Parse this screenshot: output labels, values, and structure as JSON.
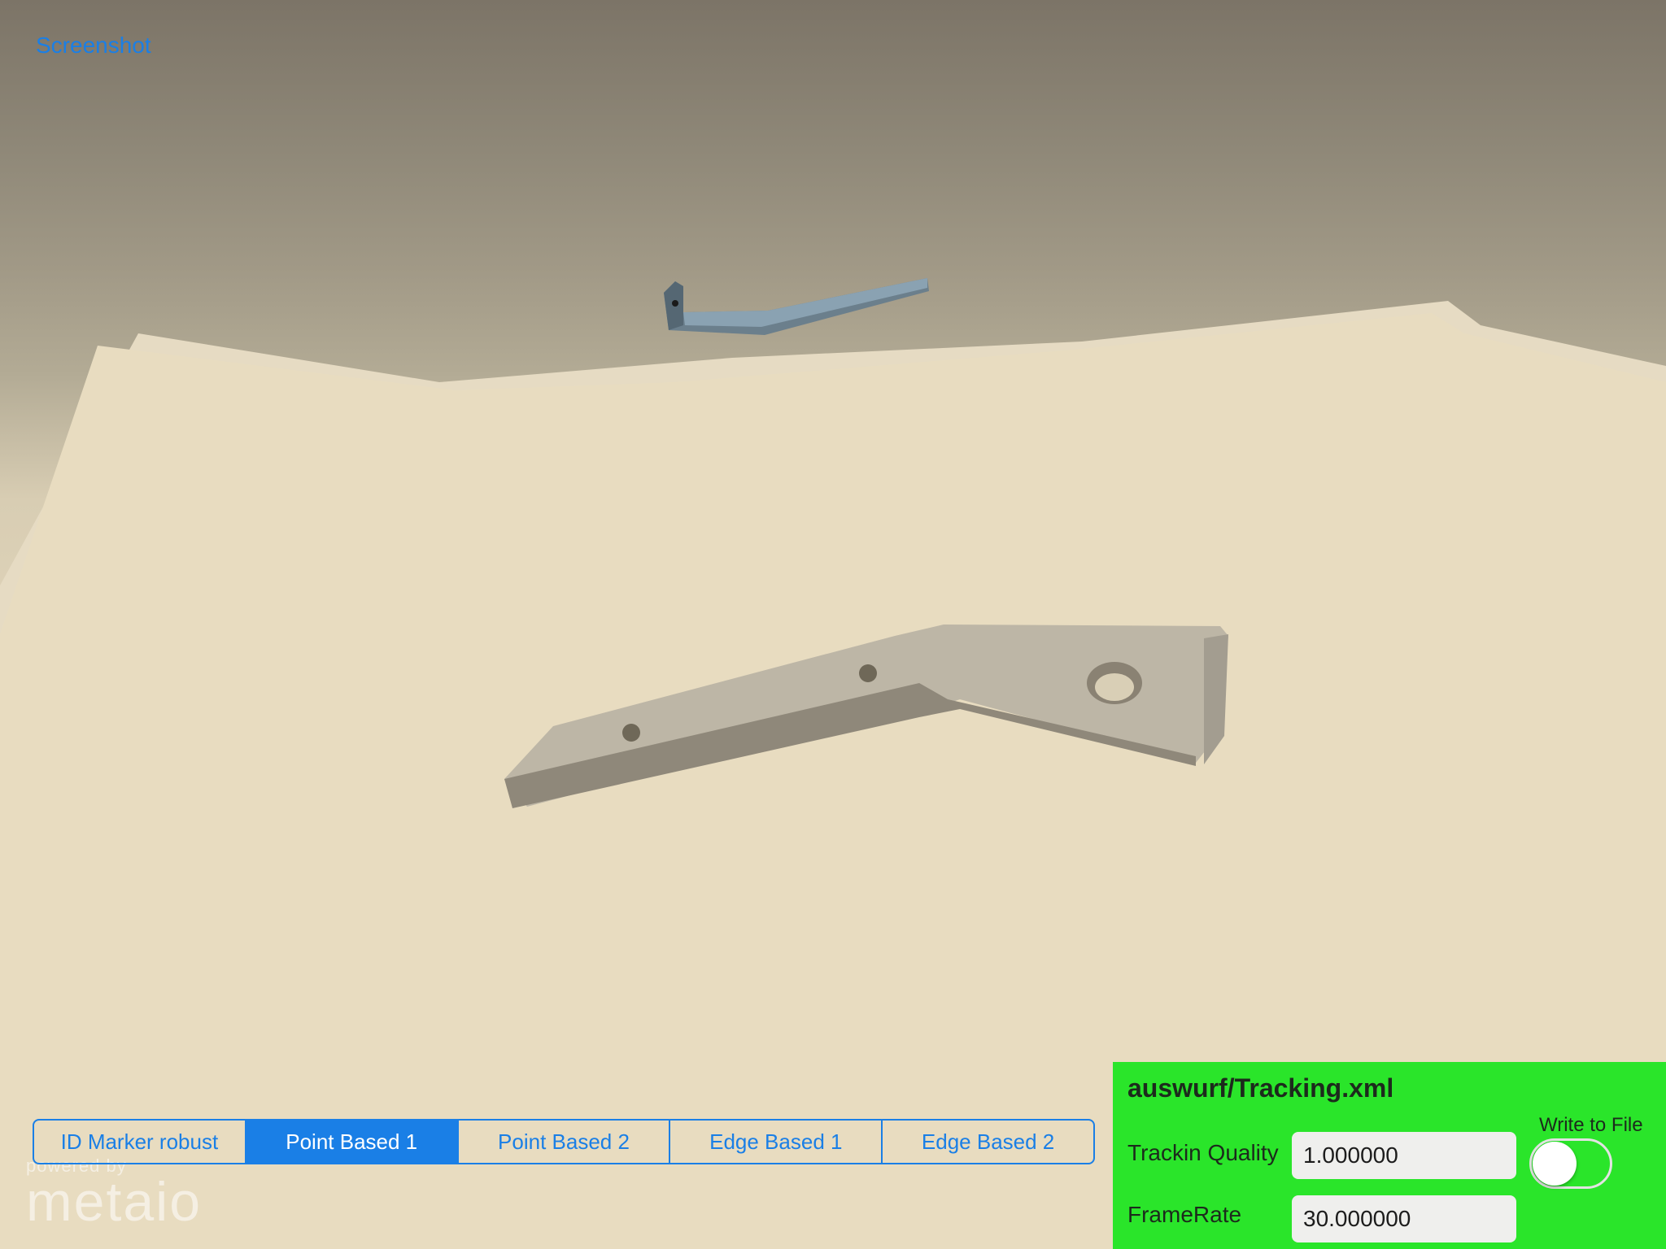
{
  "toolbar": {
    "screenshot_label": "Screenshot"
  },
  "tracking_modes": {
    "items": [
      "ID Marker robust",
      "Point Based 1",
      "Point Based 2",
      "Edge Based 1",
      "Edge Based 2"
    ],
    "selected": "Point Based 1"
  },
  "watermark": {
    "powered_by": "powered by",
    "logo": "metaio"
  },
  "info_panel": {
    "title": "auswurf/Tracking.xml",
    "quality_label": "Trackin Quality",
    "quality_value": "1.000000",
    "framerate_label": "FrameRate",
    "framerate_value": "30.000000",
    "write_to_file_label": "Write to File",
    "write_to_file_on": false
  },
  "colors": {
    "accent": "#1a7fe6",
    "panel_bg": "#2ae52a"
  }
}
